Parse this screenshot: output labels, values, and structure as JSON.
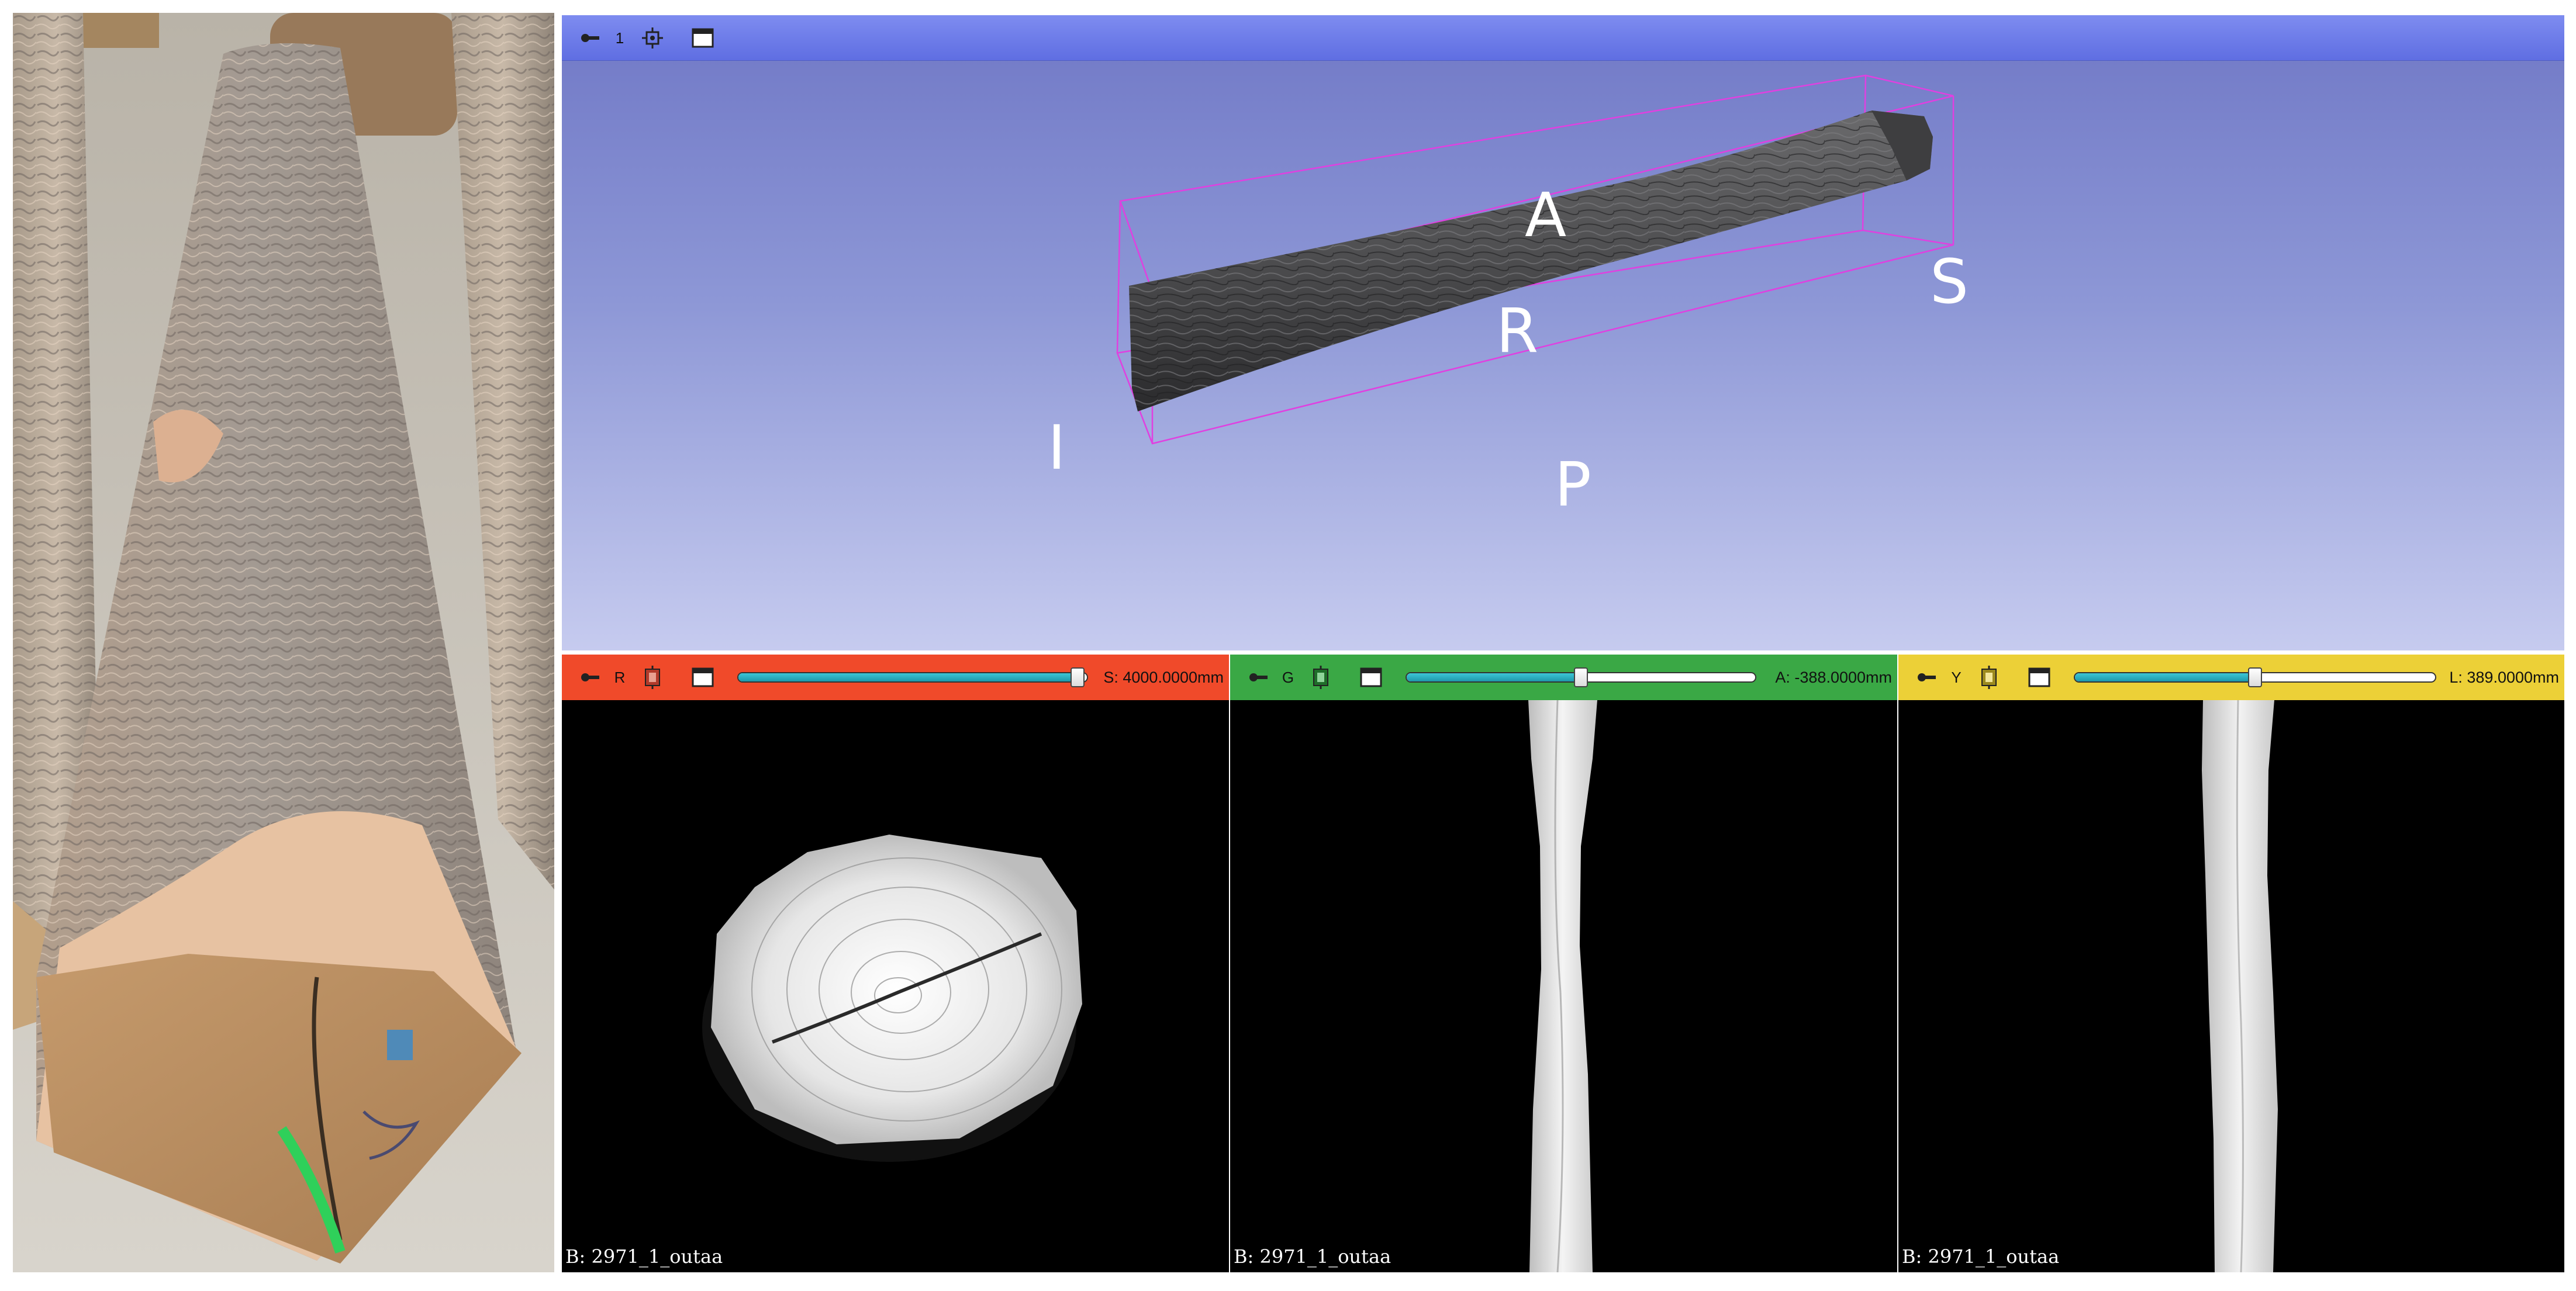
{
  "photo": {
    "caption": ""
  },
  "view3d": {
    "bar_color": "#6f7ce8",
    "pin_icon": "pin-icon",
    "view_number": "1",
    "center_icon": "center-view-icon",
    "maximize_icon": "maximize-icon",
    "orientation": {
      "anterior": "A",
      "posterior": "P",
      "right": "R",
      "inferior": "I",
      "superior": "S"
    },
    "bounding_box_color": "#e040e0"
  },
  "slices": [
    {
      "name": "red",
      "bar_color": "#f04a2a",
      "letter": "R",
      "slider_fraction": 0.97,
      "offset_text": "S: 4000.0000mm",
      "volume_label": "B: 2971_1_outaa"
    },
    {
      "name": "green",
      "bar_color": "#3aa845",
      "letter": "G",
      "slider_fraction": 0.5,
      "offset_text": "A: -388.0000mm",
      "volume_label": "B: 2971_1_outaa"
    },
    {
      "name": "yellow",
      "bar_color": "#ecd037",
      "letter": "Y",
      "slider_fraction": 0.5,
      "offset_text": "L: 389.0000mm",
      "volume_label": "B: 2971_1_outaa"
    }
  ]
}
